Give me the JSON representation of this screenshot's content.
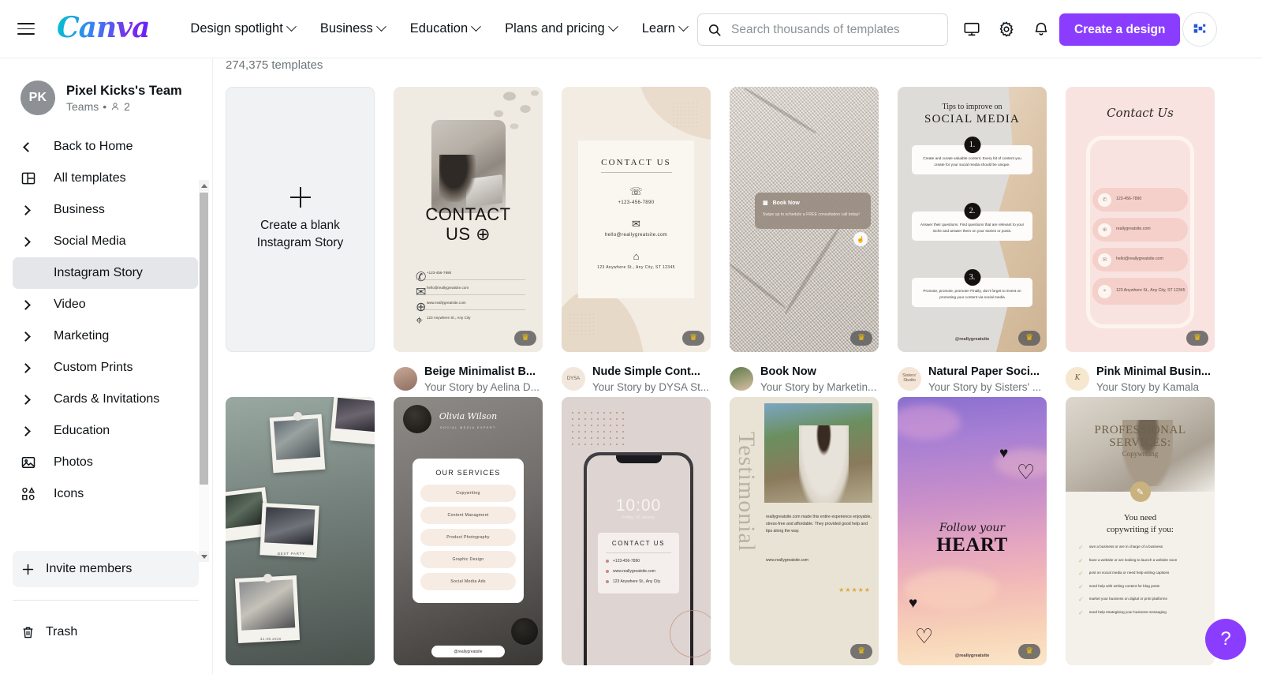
{
  "header": {
    "logo_text": "Canva",
    "nav": [
      {
        "label": "Design spotlight",
        "has_chevron": true
      },
      {
        "label": "Business",
        "has_chevron": true
      },
      {
        "label": "Education",
        "has_chevron": true
      },
      {
        "label": "Plans and pricing",
        "has_chevron": true
      },
      {
        "label": "Learn",
        "has_chevron": true
      }
    ],
    "search": {
      "placeholder": "Search thousands of templates",
      "value": ""
    },
    "icons": [
      "monitor-icon",
      "gear-icon",
      "bell-icon"
    ],
    "create_button": "Create a design",
    "avatar_icon": "pixel-kicks-logo"
  },
  "sidebar": {
    "team": {
      "initials": "PK",
      "name": "Pixel Kicks's Team",
      "sub": "Teams",
      "members_count": "2"
    },
    "items": [
      {
        "label": "Back to Home",
        "icon": "chevron-left-icon"
      },
      {
        "label": "All templates",
        "icon": "templates-icon"
      },
      {
        "label": "Business",
        "icon": "chevron-right-icon"
      },
      {
        "label": "Social Media",
        "icon": "chevron-right-icon"
      },
      {
        "label": "Instagram Story",
        "icon": "none",
        "active": true
      },
      {
        "label": "Video",
        "icon": "chevron-right-icon"
      },
      {
        "label": "Marketing",
        "icon": "chevron-right-icon"
      },
      {
        "label": "Custom Prints",
        "icon": "chevron-right-icon"
      },
      {
        "label": "Cards & Invitations",
        "icon": "chevron-right-icon"
      },
      {
        "label": "Education",
        "icon": "chevron-right-icon"
      },
      {
        "label": "Photos",
        "icon": "photo-icon"
      },
      {
        "label": "Icons",
        "icon": "shapes-icon"
      }
    ],
    "invite": {
      "label": "Invite members",
      "icon": "plus-icon"
    },
    "trash": {
      "label": "Trash",
      "icon": "trash-icon"
    }
  },
  "main": {
    "count_text": "274,375 templates",
    "blank_card": {
      "label": "Create a blank\nInstagram Story",
      "icon": "plus-icon"
    },
    "help_button": "?",
    "templates": [
      {
        "title": "Beige Minimalist B...",
        "author": "Your Story by Aelina D...",
        "pro": true,
        "art": {
          "headline": "CONTACT US",
          "rows": [
            {
              "icon": "phone-icon",
              "text": "+123-456-7890"
            },
            {
              "icon": "mail-icon",
              "text": "hello@reallygreatsite.com"
            },
            {
              "icon": "globe-icon",
              "text": "www.reallygreatsite.com"
            },
            {
              "icon": "pin-icon",
              "text": "123 Anywhere St., Any City"
            }
          ]
        }
      },
      {
        "title": "Nude Simple Cont...",
        "author": "Your Story by DYSA St...",
        "pro": true,
        "avatar_text": "DYSA",
        "art": {
          "headline": "CONTACT US",
          "blocks": [
            {
              "icon": "☎",
              "text": "+123-456-7890"
            },
            {
              "icon": "✉",
              "text": "hello@reallygreatsite.com"
            },
            {
              "icon": "⌂",
              "text": "123 Anywhere St., Any City, ST 12345"
            }
          ]
        }
      },
      {
        "title": "Book Now",
        "author": "Your Story by Marketin...",
        "pro": true,
        "art": {
          "card_title": "Book Now",
          "card_body": "Swipe up to schedule a FREE consultation call today!"
        }
      },
      {
        "title": "Natural Paper Soci...",
        "author": "Your Story by Sisters' ...",
        "pro": true,
        "avatar_text": "Sisters' Studio",
        "art": {
          "heading_small": "Tips to improve on",
          "heading_big": "SOCIAL MEDIA",
          "steps": [
            {
              "num": "1.",
              "text": "Create and curate valuable content. Every bit of content you create for your social media should be unique."
            },
            {
              "num": "2.",
              "text": "Answer their questions. Find questions that are relevant to your niche and answer them on your stories or posts."
            },
            {
              "num": "3.",
              "text": "Promote, promote, promote! Finally, don't forget to invest on promoting your content via social media"
            }
          ],
          "handle": "@reallygreatsite"
        }
      },
      {
        "title": "Pink Minimal Busin...",
        "author": "Your Story by Kamala",
        "pro": true,
        "avatar_text": "K",
        "art": {
          "headline": "Contact Us",
          "items": [
            {
              "icon": "phone-icon",
              "text": "123-456-7890"
            },
            {
              "icon": "globe-icon",
              "text": "reallygreatsite.com"
            },
            {
              "icon": "mail-icon",
              "text": "hello@reallygreatsite.com"
            },
            {
              "icon": "pin-icon",
              "text": "123 Anywhere St., Any City, ST 12345"
            }
          ]
        }
      },
      {
        "title": "",
        "author": "",
        "pro": false,
        "art": {
          "caption1": "BEST PARTY",
          "caption2": "31.08.2020"
        }
      },
      {
        "title": "",
        "author": "",
        "pro": false,
        "art": {
          "signature": "Olivia Wilson",
          "sub": "SOCIAL MEDIA EXPERT",
          "heading": "OUR SERVICES",
          "services": [
            "Copywriting",
            "Content Managment",
            "Product Photography",
            "Graphic Design",
            "Social Media Ads"
          ],
          "handle": "@reallygreatsite"
        }
      },
      {
        "title": "",
        "author": "",
        "pro": false,
        "art": {
          "time": "10:00",
          "date": "Friday, 14 January",
          "headline": "CONTACT US",
          "items": [
            "+123-456-7890",
            "www.reallygreatsite.com",
            "123 Anywhere St., Any City"
          ]
        }
      },
      {
        "title": "",
        "author": "",
        "pro": false,
        "art": {
          "vertical": "Testimonial",
          "quote": "reallygreatsite.com made this entire experience enjoyable, stress-free and affordable. They provided good help and tips along the way.",
          "url": "www.reallygreatsite.com",
          "stars": "★★★★★"
        }
      },
      {
        "title": "",
        "author": "",
        "pro": false,
        "art": {
          "line1": "Follow your",
          "line2": "HEART",
          "handle": "@reallygreatsite"
        }
      },
      {
        "title": "",
        "author": "",
        "pro": false,
        "art": {
          "h1": "PROFESSIONAL",
          "h2": "SERVICES:",
          "h3": "Copywriting",
          "sub": "You need\ncopywriting if you:",
          "bullets": [
            "own a business or are in charge of a business",
            "have a website or are looking to launch a website soon",
            "post on social media or need help writing captions",
            "need help with writing content for blog posts",
            "market your business on digital or print platforms",
            "need help strategising your business messaging"
          ]
        }
      }
    ]
  },
  "colors": {
    "brand_purple": "#8b3dff",
    "logo_cyan": "#00c4cc",
    "crown_gold": "#ffc700",
    "active_gray": "#e4e6e9"
  }
}
